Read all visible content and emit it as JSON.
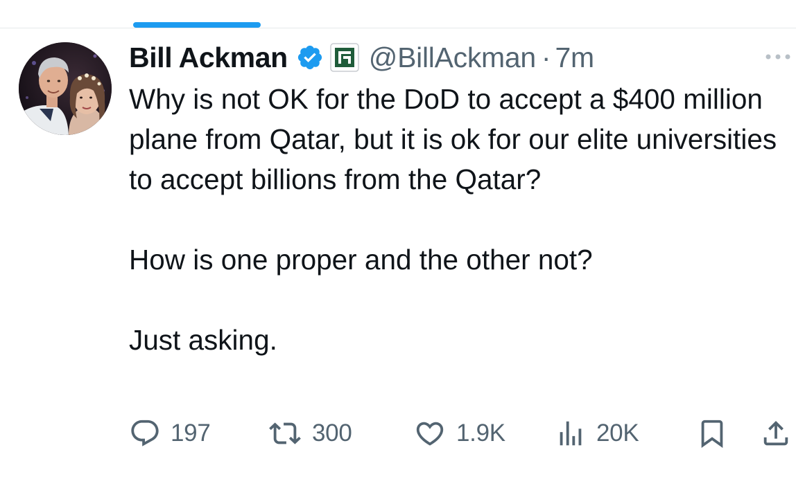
{
  "tweet": {
    "author": {
      "display_name": "Bill Ackman",
      "handle": "@BillAckman",
      "verified": true,
      "verified_icon": "verified-badge-icon",
      "affiliate_icon": "pershing-square-affiliate-icon"
    },
    "separator": "·",
    "timestamp": "7m",
    "paragraphs": [
      "Why is not OK for the DoD to accept a $400 million plane from Qatar, but it is ok for our elite universities to accept billions from the Qatar?",
      "How is one proper and the other not?",
      "Just asking."
    ],
    "actions": {
      "replies": {
        "icon": "reply-icon",
        "count": "197"
      },
      "reposts": {
        "icon": "repost-icon",
        "count": "300"
      },
      "likes": {
        "icon": "heart-icon",
        "count": "1.9K"
      },
      "views": {
        "icon": "views-chart-icon",
        "count": "20K"
      },
      "bookmark": {
        "icon": "bookmark-icon"
      },
      "share": {
        "icon": "share-icon"
      }
    }
  },
  "colors": {
    "accent": "#1d9bf0",
    "text_primary": "#0f1419",
    "text_secondary": "#536471",
    "affiliate_green": "#1f5c3a"
  }
}
